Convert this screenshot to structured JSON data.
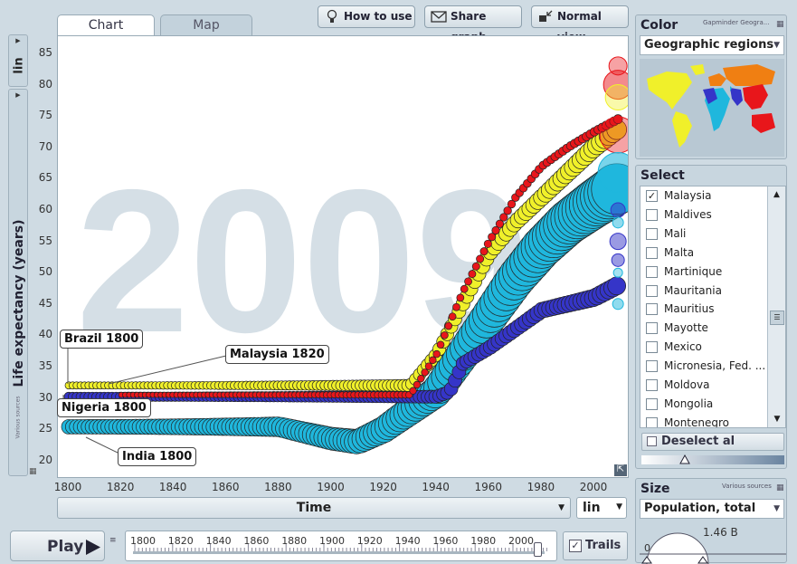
{
  "tabs": {
    "chart": "Chart",
    "map": "Map"
  },
  "toolbar": {
    "how_to_use": "How to use",
    "share_graph": "Share graph",
    "normal_view": "Normal view"
  },
  "axes": {
    "y_scale": "lin",
    "y_label": "Life expectancy (years)",
    "y_ticks": [
      "85",
      "80",
      "75",
      "70",
      "65",
      "60",
      "55",
      "50",
      "45",
      "40",
      "35",
      "30",
      "25",
      "20"
    ],
    "x_label": "Time",
    "x_scale": "lin",
    "x_ticks": [
      "1800",
      "1820",
      "1840",
      "1860",
      "1880",
      "1900",
      "1920",
      "1940",
      "1960",
      "1980",
      "2000"
    ],
    "various_sources": "Various sources"
  },
  "watermark_year": "2009",
  "callouts": {
    "brazil": "Brazil 1800",
    "malaysia": "Malaysia 1820",
    "nigeria": "Nigeria 1800",
    "india": "India 1800"
  },
  "color_panel": {
    "title": "Color",
    "credit": "Gapminder Geogra...",
    "selected": "Geographic regions"
  },
  "select_panel": {
    "title": "Select",
    "items": [
      {
        "label": "Malaysia",
        "checked": true
      },
      {
        "label": "Maldives",
        "checked": false
      },
      {
        "label": "Mali",
        "checked": false
      },
      {
        "label": "Malta",
        "checked": false
      },
      {
        "label": "Martinique",
        "checked": false
      },
      {
        "label": "Mauritania",
        "checked": false
      },
      {
        "label": "Mauritius",
        "checked": false
      },
      {
        "label": "Mayotte",
        "checked": false
      },
      {
        "label": "Mexico",
        "checked": false
      },
      {
        "label": "Micronesia, Fed. ...",
        "checked": false
      },
      {
        "label": "Moldova",
        "checked": false
      },
      {
        "label": "Mongolia",
        "checked": false
      },
      {
        "label": "Montenegro",
        "checked": false
      }
    ],
    "deselect": "Deselect al"
  },
  "size_panel": {
    "title": "Size",
    "credit": "Various sources",
    "selected": "Population, total",
    "value": "1.46 B",
    "min": "0"
  },
  "player": {
    "play": "Play",
    "trails": "Trails",
    "trails_checked": true,
    "ticks": [
      "1800",
      "1820",
      "1840",
      "1860",
      "1880",
      "1900",
      "1920",
      "1940",
      "1960",
      "1980",
      "2000"
    ]
  },
  "colors": {
    "asia": "#e8161b",
    "americas": "#f0f02a",
    "africa": "#1fb7dd",
    "europe": "#f07f12",
    "sasia": "#3535c8"
  }
}
